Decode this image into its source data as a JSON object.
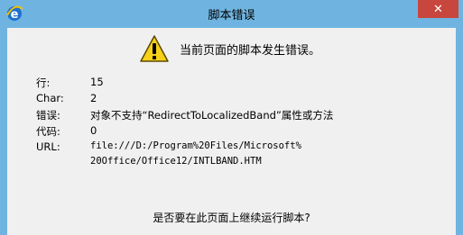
{
  "window": {
    "title": "脚本错误",
    "close_label": "✕"
  },
  "dialog": {
    "headline": "当前页面的脚本发生错误。",
    "details": [
      {
        "label": "行:",
        "value": "15"
      },
      {
        "label": "Char:",
        "value": "2"
      },
      {
        "label": "错误:",
        "value": "对象不支持“RedirectToLocalizedBand”属性或方法"
      },
      {
        "label": "代码:",
        "value": "0"
      },
      {
        "label": "URL:",
        "value": "file:///D:/Program%20Files/Microsoft%",
        "value2": "20Office/Office12/INTLBAND.HTM"
      }
    ],
    "question": "是否要在此页面上继续运行脚本?"
  },
  "colors": {
    "titlebar": "#6fb4e0",
    "close": "#c7463d",
    "client": "#f0f0f0",
    "warning": "#f7d117"
  },
  "icons": {
    "app": "internet-explorer-icon",
    "warning": "warning-triangle-icon"
  }
}
